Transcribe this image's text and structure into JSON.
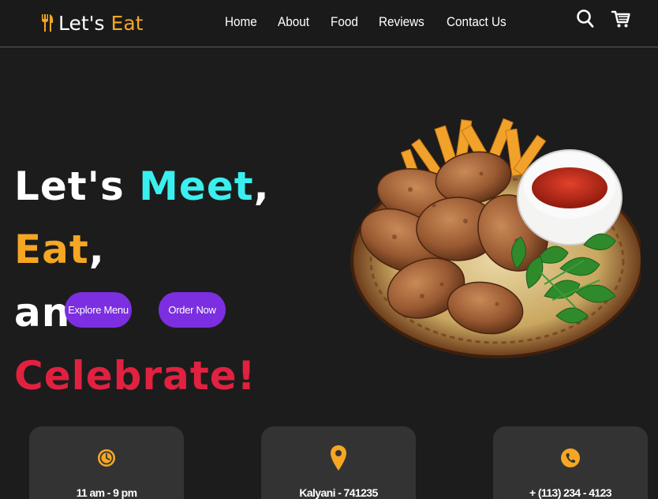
{
  "header": {
    "logo_part1": "Let's",
    "logo_part2": "Eat",
    "logo_icon": "fork-knife-icon",
    "nav": [
      "Home",
      "About",
      "Food",
      "Reviews",
      "Contact Us"
    ],
    "search_icon": "search-icon",
    "cart_icon": "cart-icon"
  },
  "hero": {
    "line1_a": "Let's ",
    "line1_b": "Meet",
    "line1_c": ", ",
    "line1_d": "Eat",
    "line1_e": ",",
    "line2_a": "and ",
    "line2_b": "Celebrate!",
    "explore_label": "Explore Menu",
    "order_label": "Order Now"
  },
  "cards": [
    {
      "icon": "clock-icon",
      "text": "11 am - 9 pm"
    },
    {
      "icon": "location-pin-icon",
      "text": "Kalyani - 741235"
    },
    {
      "icon": "phone-icon",
      "text": "+ (113) 234 - 4123"
    }
  ],
  "colors": {
    "background": "#1c1c1c",
    "accent_orange": "#f5a623",
    "accent_cyan": "#3af0ef",
    "accent_red": "#e0213f",
    "button_purple": "#7b2fe0",
    "card_bg": "#333333"
  }
}
